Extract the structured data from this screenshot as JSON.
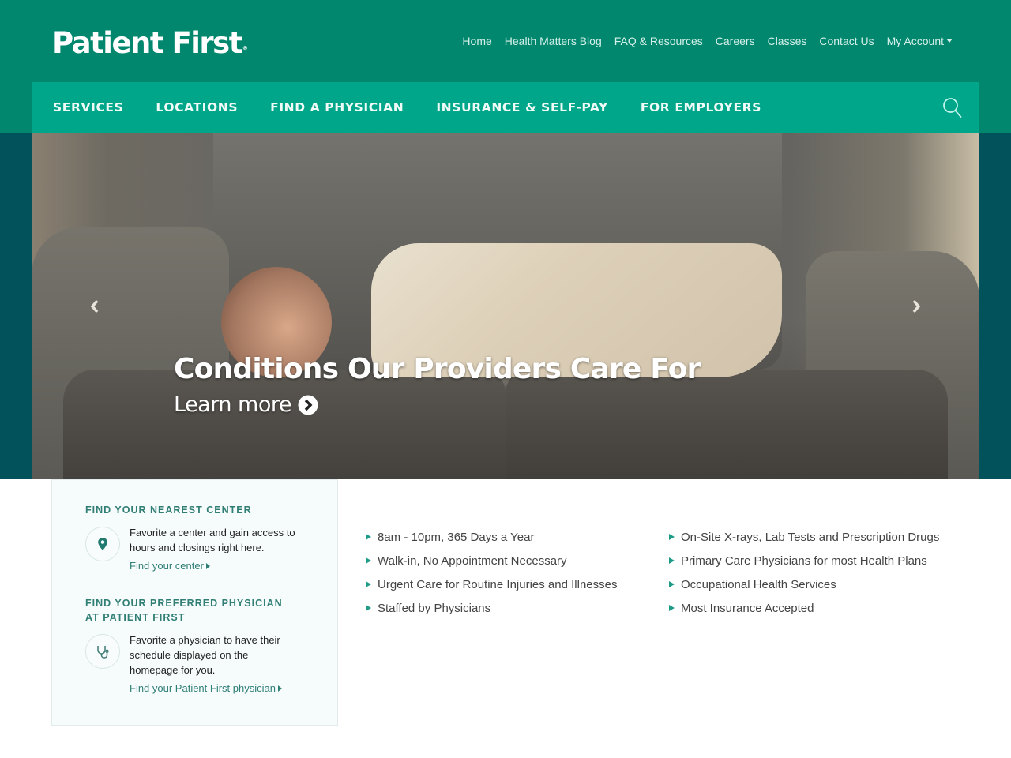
{
  "brand": {
    "name": "Patient First",
    "trademark": "®",
    "colors": {
      "header_green": "#00876e",
      "nav_teal": "#00a68a",
      "hero_side": "#02525c",
      "accent_text": "#317f74",
      "bullet": "#1c9c87"
    }
  },
  "utility_nav": {
    "items": [
      {
        "label": "Home"
      },
      {
        "label": "Health Matters Blog"
      },
      {
        "label": "FAQ & Resources"
      },
      {
        "label": "Careers"
      },
      {
        "label": "Classes"
      },
      {
        "label": "Contact Us"
      },
      {
        "label": "My Account",
        "has_dropdown": true
      }
    ]
  },
  "main_nav": {
    "items": [
      {
        "label": "SERVICES"
      },
      {
        "label": "LOCATIONS"
      },
      {
        "label": "FIND A PHYSICIAN"
      },
      {
        "label": "INSURANCE & SELF-PAY"
      },
      {
        "label": "FOR EMPLOYERS"
      }
    ],
    "search_icon": "search-icon"
  },
  "hero": {
    "title": "Conditions Our Providers Care For",
    "link_label": "Learn more",
    "link_icon": "circle-chevron-right-icon",
    "prev_icon": "chevron-left-icon",
    "next_icon": "chevron-right-icon",
    "image_description": "Child sleeping under a star quilt on a gray tufted sofa"
  },
  "side_card": {
    "sections": [
      {
        "heading": "FIND YOUR NEAREST CENTER",
        "icon": "map-pin-icon",
        "description": "Favorite a center and gain access to hours and closings right here.",
        "link": "Find your center"
      },
      {
        "heading": "FIND YOUR PREFERRED PHYSICIAN AT PATIENT FIRST",
        "icon": "stethoscope-icon",
        "description": "Favorite a physician to have their schedule displayed on the homepage for you.",
        "link": "Find your Patient First physician"
      }
    ]
  },
  "features": {
    "col1": [
      "8am - 10pm, 365 Days a Year",
      "Walk-in, No Appointment Necessary",
      "Urgent Care for Routine Injuries and Illnesses",
      "Staffed by Physicians"
    ],
    "col2": [
      "On-Site X-rays, Lab Tests and Prescription Drugs",
      "Primary Care Physicians for most Health Plans",
      "Occupational Health Services",
      "Most Insurance Accepted"
    ]
  }
}
